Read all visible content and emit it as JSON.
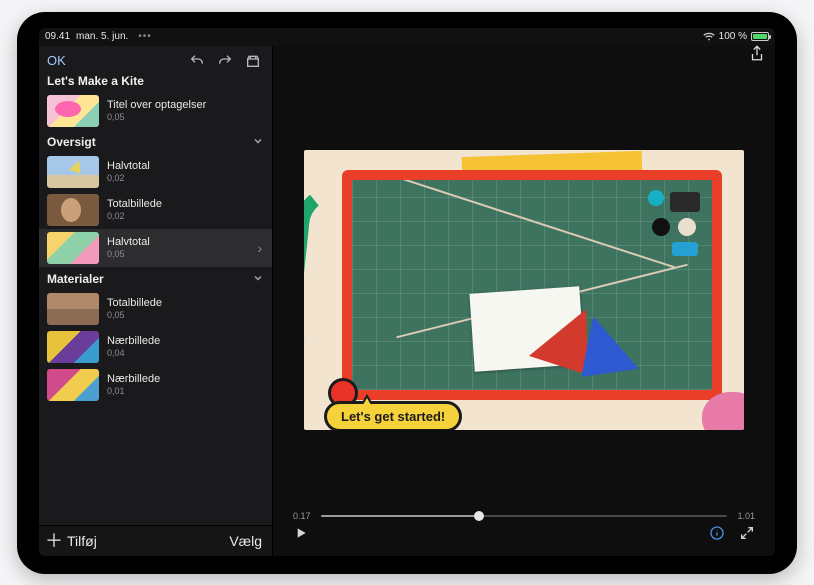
{
  "status": {
    "time": "09.41",
    "date": "man. 5. jun.",
    "battery_pct": "100 %"
  },
  "topbar": {
    "ok": "OK"
  },
  "project": {
    "title": "Let's Make a Kite"
  },
  "title_clip": {
    "label": "Titel over optagelser",
    "duration": "0,05"
  },
  "sections": [
    {
      "name": "Oversigt",
      "clips": [
        {
          "label": "Halvtotal",
          "duration": "0,02",
          "thumb": "t-kite"
        },
        {
          "label": "Totalbillede",
          "duration": "0,02",
          "thumb": "t-face"
        },
        {
          "label": "Halvtotal",
          "duration": "0,05",
          "thumb": "t-collage",
          "selected": true,
          "disclosure": true
        }
      ]
    },
    {
      "name": "Materialer",
      "clips": [
        {
          "label": "Totalbillede",
          "duration": "0,05",
          "thumb": "t-shelf"
        },
        {
          "label": "Nærbillede",
          "duration": "0,04",
          "thumb": "t-craft1"
        },
        {
          "label": "Nærbillede",
          "duration": "0,01",
          "thumb": "t-craft2"
        }
      ]
    }
  ],
  "bottom": {
    "add": "Tilføj",
    "select": "Vælg"
  },
  "preview": {
    "bubble_text": "Let's get started!",
    "time_left": "0.17",
    "time_right": "1.01"
  }
}
